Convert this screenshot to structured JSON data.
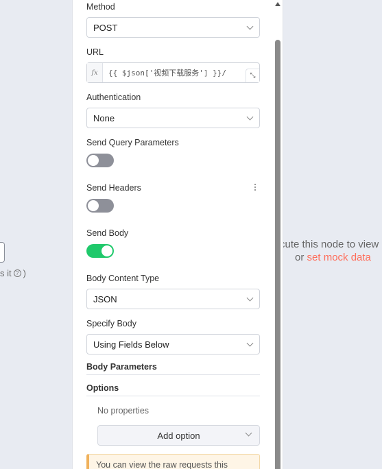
{
  "background": {
    "left_hint_suffix": "s it",
    "left_hint_close": ")",
    "right_message": {
      "line1": "cute this node to view",
      "line2_prefix": "or",
      "link": "set mock data"
    }
  },
  "panel": {
    "method": {
      "label": "Method",
      "value": "POST"
    },
    "url": {
      "label": "URL",
      "fx": "fx",
      "value": "{{ $json['视频下载服务'] }}/"
    },
    "authentication": {
      "label": "Authentication",
      "value": "None"
    },
    "send_query_parameters": {
      "label": "Send Query Parameters",
      "enabled": false
    },
    "send_headers": {
      "label": "Send Headers",
      "enabled": false
    },
    "send_body": {
      "label": "Send Body",
      "enabled": true
    },
    "body_content_type": {
      "label": "Body Content Type",
      "value": "JSON"
    },
    "specify_body": {
      "label": "Specify Body",
      "value": "Using Fields Below"
    },
    "body_parameters": {
      "title": "Body Parameters"
    },
    "options": {
      "title": "Options",
      "empty_text": "No properties",
      "add_button": "Add option"
    },
    "notice": {
      "text": "You can view the raw requests this"
    }
  },
  "colors": {
    "accent": "#ff6d5a",
    "toggle_on": "#1fc96b",
    "toggle_off": "#8e9099",
    "background": "#e8ebf2"
  }
}
